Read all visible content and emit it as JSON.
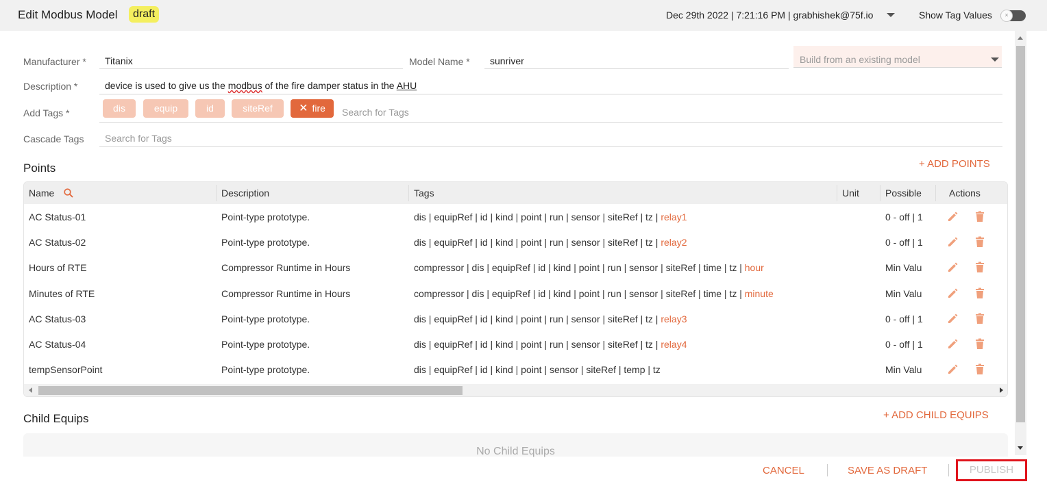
{
  "header": {
    "title": "Edit Modbus Model",
    "badge": "draft",
    "datetime_user": "Dec 29th 2022 | 7:21:16 PM | grabhishek@75f.io",
    "show_tag_values_label": "Show Tag Values",
    "toggle_glyph": "×"
  },
  "form": {
    "manufacturer_label": "Manufacturer *",
    "manufacturer_value": "Titanix",
    "model_name_label": "Model Name *",
    "model_name_value": "sunriver",
    "build_from_placeholder": "Build from an existing model",
    "description_label": "Description *",
    "description_parts": [
      "device is used to give us the ",
      "modbus",
      " of the fire damper status in the ",
      "AHU"
    ],
    "add_tags_label": "Add Tags *",
    "tags": [
      "dis",
      "equip",
      "id",
      "siteRef",
      "fire"
    ],
    "tags_placeholder": "Search for Tags",
    "cascade_tags_label": "Cascade Tags",
    "cascade_placeholder": "Search for Tags"
  },
  "points": {
    "title": "Points",
    "add_label": "+ ADD POINTS",
    "columns": [
      "Name",
      "Description",
      "Tags",
      "Unit",
      "Possible",
      "Actions"
    ],
    "rows": [
      {
        "name": "AC Status-01",
        "description": "Point-type prototype.",
        "tags": "dis | equipRef | id | kind | point | run | sensor | siteRef | tz | ",
        "tag_hl": "relay1",
        "unit": "",
        "possible": "0 - off | 1"
      },
      {
        "name": "AC Status-02",
        "description": "Point-type prototype.",
        "tags": "dis | equipRef | id | kind | point | run | sensor | siteRef | tz | ",
        "tag_hl": "relay2",
        "unit": "",
        "possible": "0 - off | 1"
      },
      {
        "name": "Hours of RTE",
        "description": "Compressor Runtime in Hours",
        "tags": "compressor | dis | equipRef | id | kind | point | run | sensor | siteRef | time | tz | ",
        "tag_hl": "hour",
        "unit": "",
        "possible": "Min Valu"
      },
      {
        "name": "Minutes of RTE",
        "description": "Compressor Runtime in Hours",
        "tags": "compressor | dis | equipRef | id | kind | point | run | sensor | siteRef | time | tz | ",
        "tag_hl": "minute",
        "unit": "",
        "possible": "Min Valu"
      },
      {
        "name": "AC Status-03",
        "description": "Point-type prototype.",
        "tags": "dis | equipRef | id | kind | point | run | sensor | siteRef | tz | ",
        "tag_hl": "relay3",
        "unit": "",
        "possible": "0 - off | 1"
      },
      {
        "name": "AC Status-04",
        "description": "Point-type prototype.",
        "tags": "dis | equipRef | id | kind | point | run | sensor | siteRef | tz | ",
        "tag_hl": "relay4",
        "unit": "",
        "possible": "0 - off | 1"
      },
      {
        "name": "tempSensorPoint",
        "description": "Point-type prototype.",
        "tags": "dis | equipRef | id | kind | point | sensor | siteRef | temp | tz",
        "tag_hl": "",
        "unit": "",
        "possible": "Min Valu"
      }
    ]
  },
  "child_equips": {
    "title": "Child Equips",
    "add_label": "+ ADD CHILD EQUIPS",
    "empty_text": "No Child Equips"
  },
  "footer": {
    "cancel": "CANCEL",
    "save_draft": "SAVE AS DRAFT",
    "publish": "PUBLISH"
  },
  "colors": {
    "accent": "#e2683c",
    "chip_inactive": "#f6c7b4",
    "badge": "#f4ef5f",
    "highlight_border": "#e0141c"
  },
  "icons": [
    "search-icon",
    "edit-icon",
    "trash-icon",
    "close-icon",
    "chevron-down-icon"
  ]
}
